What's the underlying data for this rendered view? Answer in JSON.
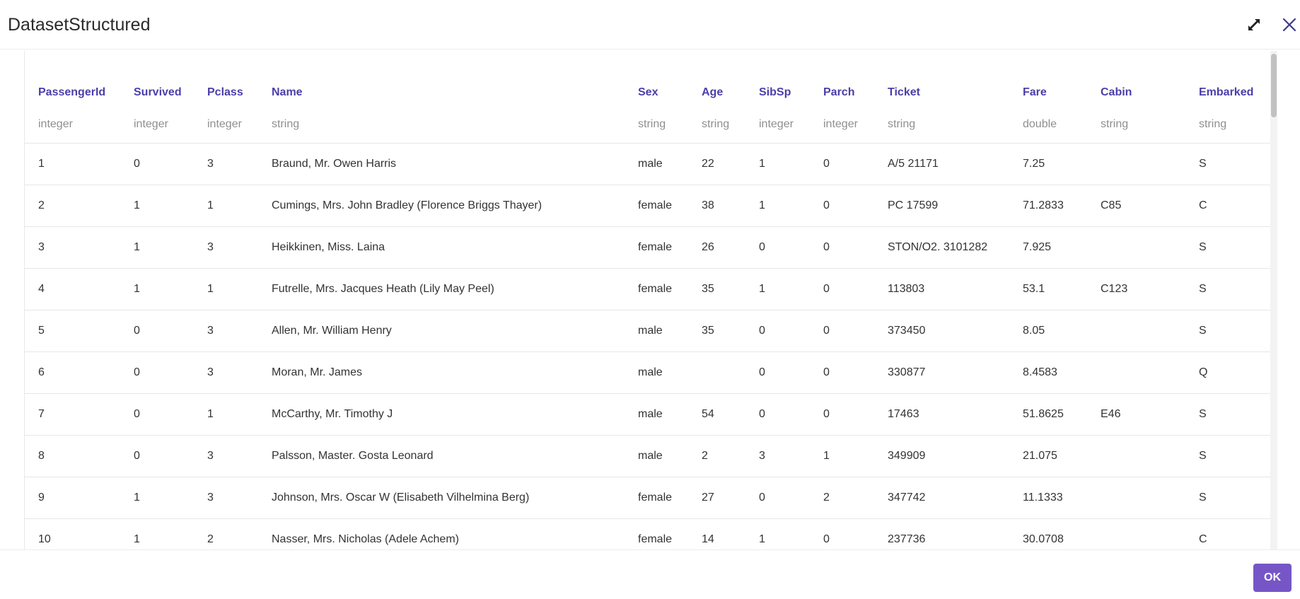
{
  "dialog": {
    "title": "DatasetStructured",
    "ok_label": "OK",
    "icons": {
      "expand": "expand-arrows-icon",
      "close": "close-x-icon"
    },
    "colors": {
      "header_text": "#4a3fa8",
      "type_text": "#8f8f8f",
      "ok_button": "#7656c6"
    }
  },
  "table": {
    "columns": [
      {
        "name": "PassengerId",
        "type": "integer"
      },
      {
        "name": "Survived",
        "type": "integer"
      },
      {
        "name": "Pclass",
        "type": "integer"
      },
      {
        "name": "Name",
        "type": "string"
      },
      {
        "name": "Sex",
        "type": "string"
      },
      {
        "name": "Age",
        "type": "string"
      },
      {
        "name": "SibSp",
        "type": "integer"
      },
      {
        "name": "Parch",
        "type": "integer"
      },
      {
        "name": "Ticket",
        "type": "string"
      },
      {
        "name": "Fare",
        "type": "double"
      },
      {
        "name": "Cabin",
        "type": "string"
      },
      {
        "name": "Embarked",
        "type": "string"
      }
    ],
    "rows": [
      [
        "1",
        "0",
        "3",
        "Braund, Mr. Owen Harris",
        "male",
        "22",
        "1",
        "0",
        "A/5 21171",
        "7.25",
        "",
        "S"
      ],
      [
        "2",
        "1",
        "1",
        "Cumings, Mrs. John Bradley (Florence Briggs Thayer)",
        "female",
        "38",
        "1",
        "0",
        "PC 17599",
        "71.2833",
        "C85",
        "C"
      ],
      [
        "3",
        "1",
        "3",
        "Heikkinen, Miss. Laina",
        "female",
        "26",
        "0",
        "0",
        "STON/O2. 3101282",
        "7.925",
        "",
        "S"
      ],
      [
        "4",
        "1",
        "1",
        "Futrelle, Mrs. Jacques Heath (Lily May Peel)",
        "female",
        "35",
        "1",
        "0",
        "113803",
        "53.1",
        "C123",
        "S"
      ],
      [
        "5",
        "0",
        "3",
        "Allen, Mr. William Henry",
        "male",
        "35",
        "0",
        "0",
        "373450",
        "8.05",
        "",
        "S"
      ],
      [
        "6",
        "0",
        "3",
        "Moran, Mr. James",
        "male",
        "",
        "0",
        "0",
        "330877",
        "8.4583",
        "",
        "Q"
      ],
      [
        "7",
        "0",
        "1",
        "McCarthy, Mr. Timothy J",
        "male",
        "54",
        "0",
        "0",
        "17463",
        "51.8625",
        "E46",
        "S"
      ],
      [
        "8",
        "0",
        "3",
        "Palsson, Master. Gosta Leonard",
        "male",
        "2",
        "3",
        "1",
        "349909",
        "21.075",
        "",
        "S"
      ],
      [
        "9",
        "1",
        "3",
        "Johnson, Mrs. Oscar W (Elisabeth Vilhelmina Berg)",
        "female",
        "27",
        "0",
        "2",
        "347742",
        "11.1333",
        "",
        "S"
      ],
      [
        "10",
        "1",
        "2",
        "Nasser, Mrs. Nicholas (Adele Achem)",
        "female",
        "14",
        "1",
        "0",
        "237736",
        "30.0708",
        "",
        "C"
      ]
    ]
  }
}
